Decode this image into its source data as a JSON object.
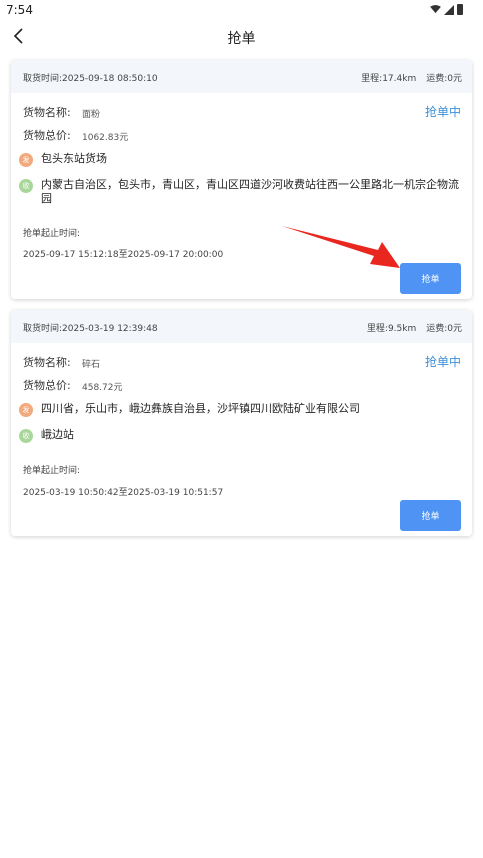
{
  "status_bar": {
    "time": "7:54"
  },
  "header": {
    "title": "抢单"
  },
  "orders": [
    {
      "pickup_time": "取货时间:2025-09-18 08:50:10",
      "distance": "里程:17.4km",
      "freight": "运费:0元",
      "cargo_label": "货物名称:",
      "cargo_name": "面粉",
      "total_label": "货物总价:",
      "total_value": "1062.83元",
      "status": "抢单中",
      "from_icon": "发",
      "from_address": "包头东站货场",
      "to_icon": "收",
      "to_address": "内蒙古自治区，包头市，青山区，青山区四道沙河收费站往西一公里路北一机宗企物流园",
      "deadline_label": "抢单起止时间:",
      "deadline_value": "2025-09-17 15:12:18至2025-09-17 20:00:00",
      "button_label": "抢单"
    },
    {
      "pickup_time": "取货时间:2025-03-19 12:39:48",
      "distance": "里程:9.5km",
      "freight": "运费:0元",
      "cargo_label": "货物名称:",
      "cargo_name": "碎石",
      "total_label": "货物总价:",
      "total_value": "458.72元",
      "status": "抢单中",
      "from_icon": "发",
      "from_address": "四川省，乐山市，峨边彝族自治县，沙坪镇四川欧陆矿业有限公司",
      "to_icon": "收",
      "to_address": "峨边站",
      "deadline_label": "抢单起止时间:",
      "deadline_value": "2025-03-19 10:50:42至2025-03-19 10:51:57",
      "button_label": "抢单"
    }
  ],
  "colors": {
    "accent": "#4f93f4",
    "status_text": "#3b8fd8",
    "send_icon": "#f2a97e",
    "receive_icon": "#a9d79a",
    "annotation_arrow": "#e8281e"
  }
}
